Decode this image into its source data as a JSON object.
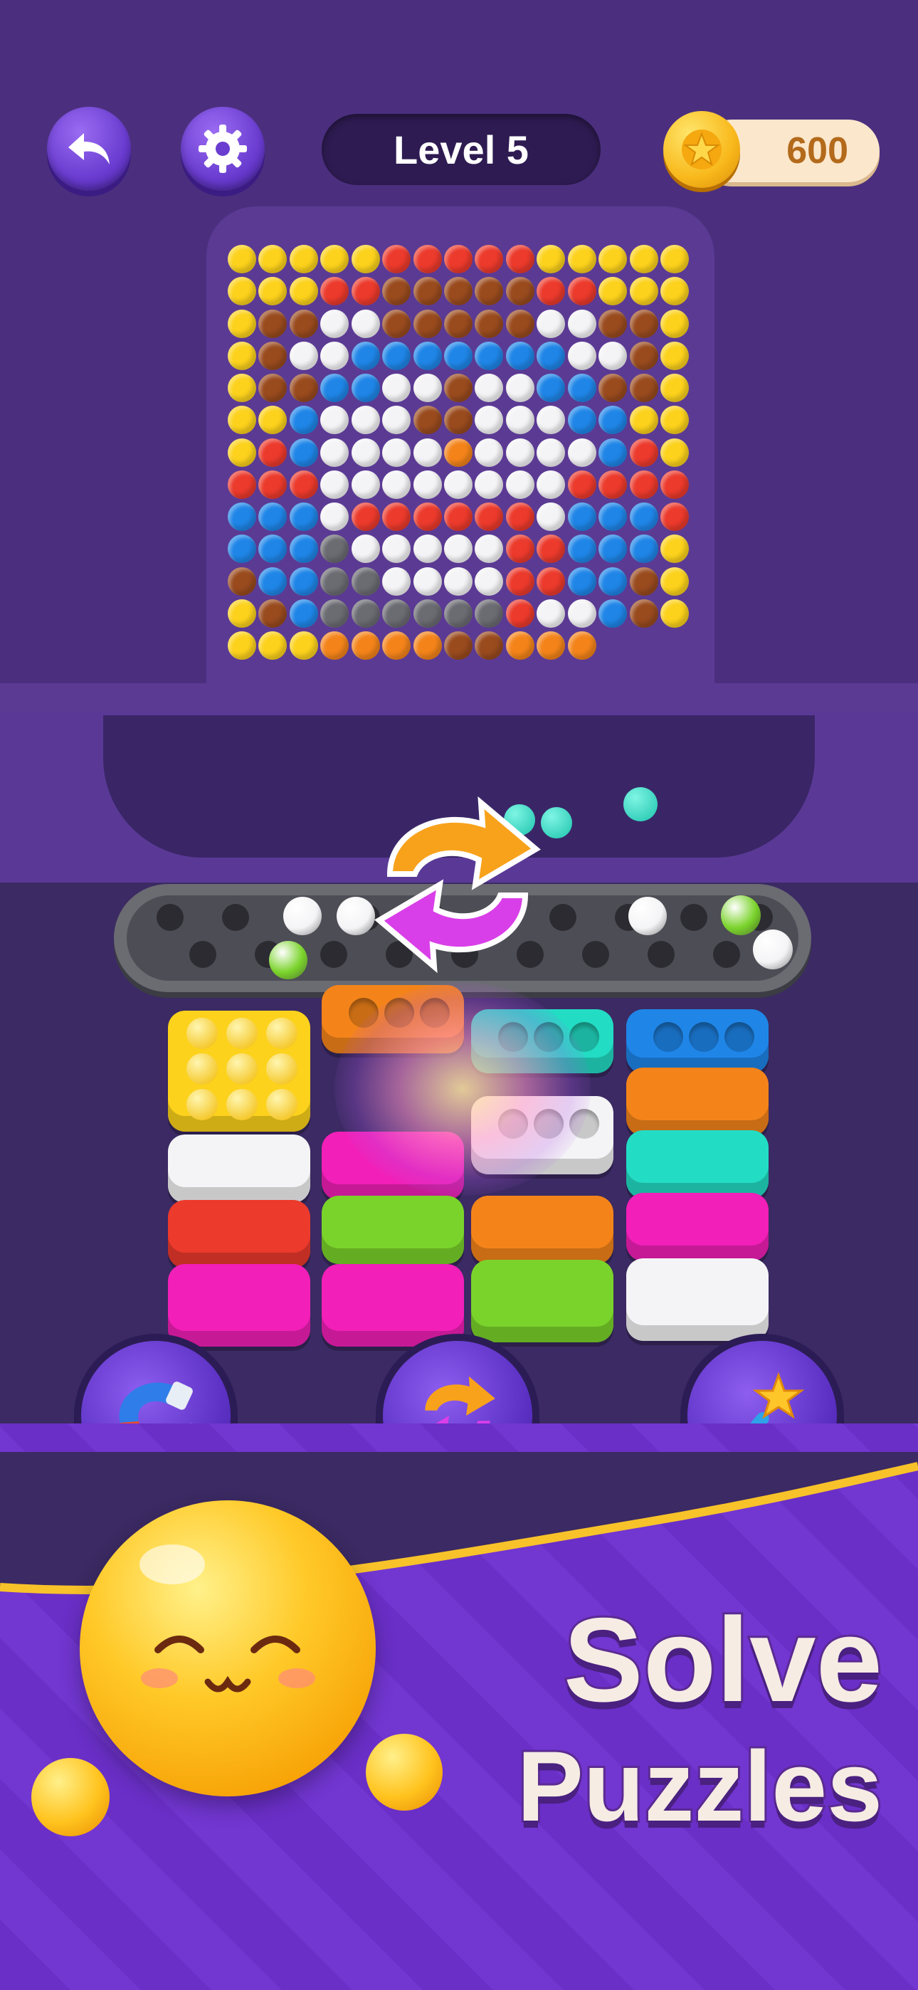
{
  "header": {
    "level_label": "Level 5",
    "coins": "600"
  },
  "icons": {
    "back": "undo-arrow-icon",
    "settings": "gear-icon",
    "coin": "star-coin-icon",
    "shuffle": "shuffle-arrows-icon",
    "magnet": "magnet-icon",
    "wand": "magic-wand-icon"
  },
  "colors": {
    "background": "#4b2f7e",
    "yellow": "#fcd21c",
    "red": "#ec3a2c",
    "brown": "#9a4b1e",
    "white": "#f4f4f6",
    "blue": "#1f86e8",
    "orange": "#f4841a",
    "gray": "#6b6b72",
    "teal": "#23dcc4",
    "pink": "#f21fb8",
    "green": "#7ad32b"
  },
  "promo": {
    "line1": "Solve",
    "line2": "Puzzles"
  }
}
